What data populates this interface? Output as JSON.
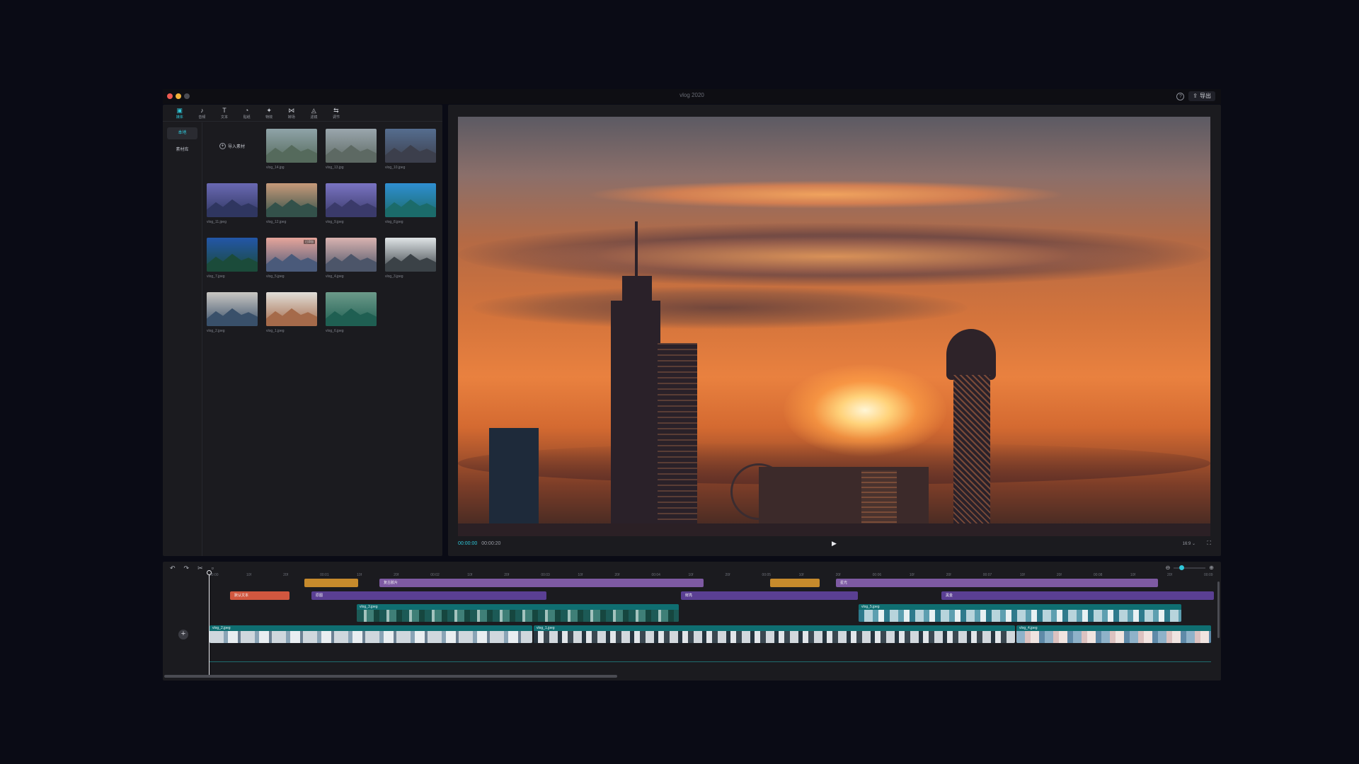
{
  "window": {
    "title": "vlog 2020",
    "export_label": "导出",
    "traffic_colors": [
      "#ee5a52",
      "#f2b33a",
      "#4a4b52"
    ]
  },
  "toolbar": {
    "items": [
      {
        "label": "媒体",
        "icon": "media-icon",
        "glyph": "▣"
      },
      {
        "label": "音频",
        "icon": "audio-icon",
        "glyph": "♪"
      },
      {
        "label": "文本",
        "icon": "text-icon",
        "glyph": "T"
      },
      {
        "label": "贴纸",
        "icon": "sticker-icon",
        "glyph": "◔"
      },
      {
        "label": "特效",
        "icon": "effects-icon",
        "glyph": "✦"
      },
      {
        "label": "转场",
        "icon": "transition-icon",
        "glyph": "⋈"
      },
      {
        "label": "滤镜",
        "icon": "filter-icon",
        "glyph": "◬"
      },
      {
        "label": "调节",
        "icon": "adjust-icon",
        "glyph": "⇆"
      }
    ]
  },
  "sidebar": {
    "items": [
      {
        "label": "本地"
      },
      {
        "label": "素材库"
      }
    ]
  },
  "media": {
    "import_label": "导入素材",
    "items": [
      {
        "label": "vlog_14.jpg",
        "colors": [
          "#8fa3a8",
          "#556a5c"
        ],
        "tag": ""
      },
      {
        "label": "vlog_13.jpg",
        "colors": [
          "#9aa6ad",
          "#5d6963"
        ],
        "tag": ""
      },
      {
        "label": "vlog_10.jpeg",
        "colors": [
          "#556d8f",
          "#3c3f4c"
        ],
        "tag": ""
      },
      {
        "label": "vlog_11.jpeg",
        "colors": [
          "#6a69b3",
          "#2f3660"
        ],
        "tag": ""
      },
      {
        "label": "vlog_12.jpeg",
        "colors": [
          "#c79a7a",
          "#33514a"
        ],
        "tag": ""
      },
      {
        "label": "vlog_9.jpeg",
        "colors": [
          "#7a74c2",
          "#3a3a6a"
        ],
        "tag": ""
      },
      {
        "label": "vlog_8.jpeg",
        "colors": [
          "#2f8fd2",
          "#1b6b6a"
        ],
        "tag": ""
      },
      {
        "label": "vlog_7.jpeg",
        "colors": [
          "#2356a8",
          "#1b4b3a"
        ],
        "tag": ""
      },
      {
        "label": "vlog_5.jpeg",
        "colors": [
          "#e6a59a",
          "#4a5a7a"
        ],
        "tag": "已添加"
      },
      {
        "label": "vlog_4.jpeg",
        "colors": [
          "#d9b3b0",
          "#4c5569"
        ],
        "tag": ""
      },
      {
        "label": "vlog_3.jpeg",
        "colors": [
          "#dfe4e6",
          "#3b4247"
        ],
        "tag": ""
      },
      {
        "label": "vlog_2.jpeg",
        "colors": [
          "#c9c7c3",
          "#39506a"
        ],
        "tag": ""
      },
      {
        "label": "vlog_1.jpeg",
        "colors": [
          "#e1ded8",
          "#a56a4a"
        ],
        "tag": ""
      },
      {
        "label": "vlog_6.jpeg",
        "colors": [
          "#6c9a8a",
          "#1f5f52"
        ],
        "tag": ""
      }
    ]
  },
  "player": {
    "current_time": "00:00:00",
    "total_time": "00:00:20",
    "ratio": "16:9"
  },
  "timeline": {
    "ruler": [
      "00:00",
      "10f",
      "20f",
      "00:01",
      "10f",
      "20f",
      "00:02",
      "10f",
      "20f",
      "00:03",
      "10f",
      "20f",
      "00:04",
      "10f",
      "20f",
      "00:05",
      "10f",
      "20f",
      "00:06",
      "10f",
      "20f",
      "00:07",
      "10f",
      "20f",
      "00:08",
      "10f",
      "20f",
      "00:09"
    ],
    "clips": [
      {
        "label": "",
        "color": "orange"
      },
      {
        "label": "复古胶片",
        "color": "purple"
      },
      {
        "label": "",
        "color": "orange"
      },
      {
        "label": "星光",
        "color": "purple"
      },
      {
        "label": "默认文本",
        "color": "red"
      },
      {
        "label": "原图",
        "color": "violet"
      },
      {
        "label": "鲜亮",
        "color": "violet"
      },
      {
        "label": "黑金",
        "color": "violet"
      }
    ],
    "overlay_video": [
      {
        "label": "vlog_3.jpeg",
        "speed": "3.0s"
      },
      {
        "label": "vlog_5.jpeg",
        "speed": "3.0s"
      }
    ],
    "main_video": [
      {
        "label": "vlog_2.jpeg",
        "speed": "3.0s"
      },
      {
        "label": "vlog_1.jpeg",
        "speed": "3.0s"
      },
      {
        "label": "vlog_4.jpeg",
        "speed": "3.0s"
      }
    ]
  },
  "colors": {
    "accent": "#2fc6d8",
    "panel": "#1b1b1f",
    "background": "#0a0b15"
  }
}
